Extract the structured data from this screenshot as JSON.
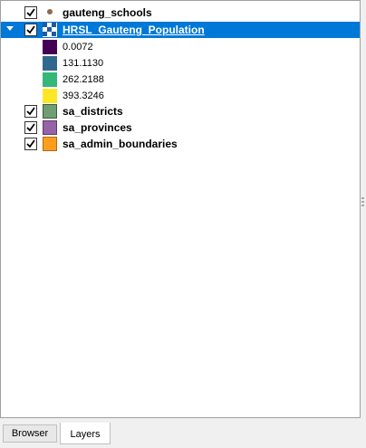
{
  "layers": [
    {
      "name": "gauteng_schools",
      "checked": true,
      "icon": "point-symbol-icon",
      "color": "#8c6a4f"
    },
    {
      "name": "HRSL_Gauteng_Population",
      "checked": true,
      "icon": "raster-icon",
      "selected": true,
      "expanded": true,
      "legend": [
        {
          "label": "0.0072",
          "color": "#440154"
        },
        {
          "label": "131.1130",
          "color": "#31688e"
        },
        {
          "label": "262.2188",
          "color": "#35b779"
        },
        {
          "label": "393.3246",
          "color": "#fde725"
        }
      ]
    },
    {
      "name": "sa_districts",
      "checked": true,
      "icon": "polygon-symbol-icon",
      "color": "#6f9e72"
    },
    {
      "name": "sa_provinces",
      "checked": true,
      "icon": "polygon-symbol-icon",
      "color": "#9563a6"
    },
    {
      "name": "sa_admin_boundaries",
      "checked": true,
      "icon": "polygon-symbol-icon",
      "color": "#ff9d1f"
    }
  ],
  "tabs": {
    "browser": "Browser",
    "layers": "Layers",
    "active": "Layers"
  },
  "colors": {
    "selection": "#0078d7"
  }
}
